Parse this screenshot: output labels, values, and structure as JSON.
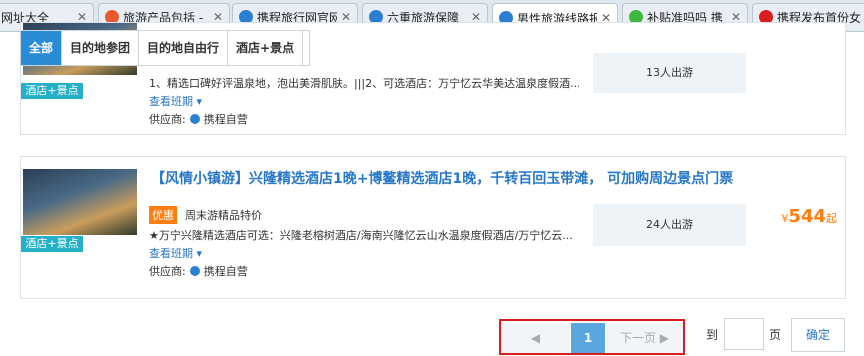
{
  "browser": {
    "tabs": [
      {
        "label": "网址大全",
        "icon": "favicon-icon",
        "color": "#dfe7ef"
      },
      {
        "label": "旅游产品包括 -",
        "icon": "sogou-icon",
        "color": "#e85a2e"
      },
      {
        "label": "携程旅行网官网",
        "icon": "ctrip-icon",
        "color": "#2b7fd1"
      },
      {
        "label": "六重旅游保障",
        "icon": "ctrip-icon",
        "color": "#2b7fd1"
      },
      {
        "label": "男性旅游线路报",
        "icon": "ctrip-icon",
        "color": "#2b7fd1"
      },
      {
        "label": "补贴准吗吗 携",
        "icon": "wechat-icon",
        "color": "#3fb83f"
      },
      {
        "label": "携程发布首份女",
        "icon": "baidu-icon",
        "color": "#d81e1e"
      }
    ],
    "close_glyph": "✕"
  },
  "filter_tabs": [
    "全部",
    "目的地参团",
    "目的地自由行",
    "酒店+景点"
  ],
  "products": [
    {
      "badge": "酒店+景点",
      "description": "1、精选口碑好评温泉地，泡出美滑肌肤。|||2、可选酒店：万宁忆云华美达温泉度假酒...",
      "more": "查看班期",
      "supplier_label": "供应商:",
      "supplier": "携程自营",
      "people": "13人出游"
    },
    {
      "badge": "酒店+景点",
      "title": "【风情小镇游】兴隆精选酒店1晚+博鳌精选酒店1晚，千转百回玉带滩， 可加购周边景点门票",
      "promo": "优惠",
      "promo_text": "周末游精品特价",
      "description": "★万宁兴隆精选酒店可选：兴隆老榕树酒店/海南兴隆忆云山水温泉度假酒店/万宁忆云...",
      "more": "查看班期",
      "supplier_label": "供应商:",
      "supplier": "携程自营",
      "people": "24人出游",
      "price_symbol": "¥",
      "price": "544",
      "price_suffix": "起"
    }
  ],
  "pagination": {
    "prev": "◀",
    "current": "1",
    "next": "下一页 ▶",
    "goto_label": "到",
    "page_unit": "页",
    "confirm": "确定"
  },
  "colors": {
    "accent": "#2a8bd6",
    "price": "#ff7e0e",
    "highlight_box": "#d81e1e"
  }
}
